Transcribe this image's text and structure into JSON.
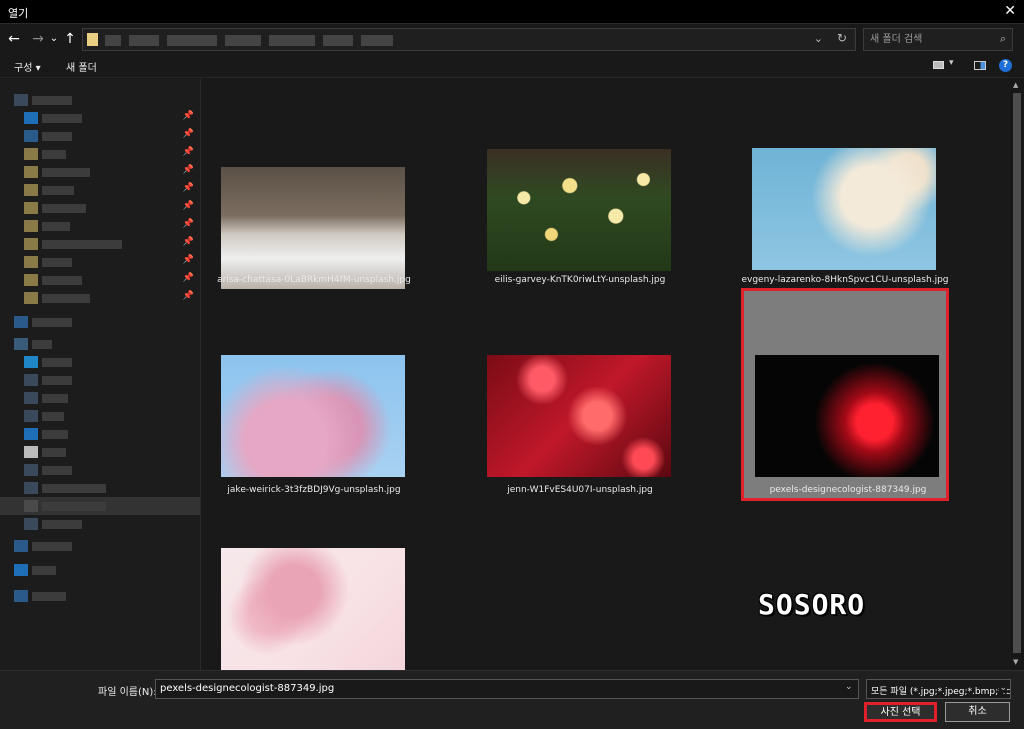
{
  "window": {
    "title": "열기",
    "close_glyph": "✕"
  },
  "nav": {
    "back": "←",
    "forward": "→",
    "recent": "⌄",
    "up": "↑"
  },
  "address": {
    "dropdown_glyph": "⌄",
    "refresh_glyph": "↻"
  },
  "search": {
    "placeholder": "새 폴더 검색",
    "icon": "search-icon"
  },
  "toolbar": {
    "organize": "구성 ▾",
    "new_folder": "새 폴더",
    "view_drop": "▾",
    "help": "?"
  },
  "files": [
    {
      "name": "arisa-chattasa-0LaBRkmH4fM-unsplash.jpg",
      "art": "paper"
    },
    {
      "name": "eilis-garvey-KnTK0riwLtY-unsplash.jpg",
      "art": "daffodils"
    },
    {
      "name": "evgeny-lazarenko-8HknSpvc1CU-unsplash.jpg",
      "art": "blossom-blue-sky"
    },
    {
      "name": "jake-weirick-3t3fzBDJ9Vg-unsplash.jpg",
      "art": "pink-tree"
    },
    {
      "name": "jenn-W1FvES4U07I-unsplash.jpg",
      "art": "red-bokeh"
    },
    {
      "name": "pexels-designecologist-887349.jpg",
      "art": "neon-heart",
      "selected": true
    },
    {
      "name": "",
      "art": "sakura"
    }
  ],
  "watermark": "SOSORO",
  "footer": {
    "filename_label": "파일 이름(N):",
    "filename_value": "pexels-designecologist-887349.jpg",
    "filetype_value": "모든 파일 (*.jpg;*.jpeg;*.bmp;*.c",
    "ok_label": "사진 선택",
    "cancel_label": "취소"
  },
  "colors": {
    "selection_outline": "#e0202a",
    "background": "#191919",
    "accent": "#1f6fd8"
  }
}
